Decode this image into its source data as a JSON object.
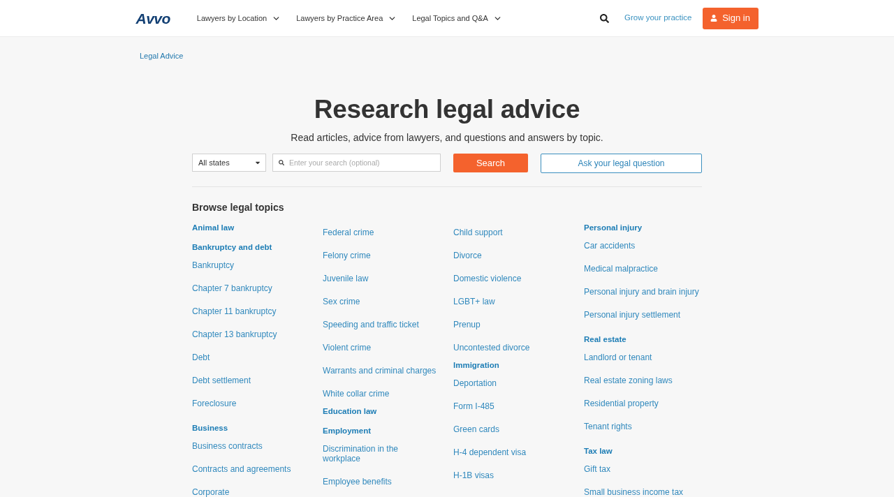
{
  "header": {
    "logo": "Avvo",
    "nav": [
      "Lawyers by Location",
      "Lawyers by Practice Area",
      "Legal Topics and Q&A"
    ],
    "grow_link": "Grow your practice",
    "sign_in": "Sign in"
  },
  "breadcrumb": "Legal Advice",
  "hero": {
    "title": "Research legal advice",
    "subtitle": "Read articles, advice from lawyers, and questions and answers by topic."
  },
  "search": {
    "state_select": {
      "value": "All states"
    },
    "query": {
      "placeholder": "Enter your search (optional)"
    },
    "search_button": "Search",
    "ask_button": "Ask your legal question"
  },
  "topics": {
    "title": "Browse legal topics",
    "columns": [
      {
        "groups": [
          {
            "heading": "Animal law"
          },
          {
            "heading": "Bankruptcy and debt",
            "links": [
              "Bankruptcy",
              "Chapter 7 bankruptcy",
              "Chapter 11 bankruptcy",
              "Chapter 13 bankruptcy",
              "Debt",
              "Debt settlement",
              "Foreclosure"
            ]
          },
          {
            "heading": "Business",
            "links": [
              "Business contracts",
              "Contracts and agreements",
              "Corporate"
            ]
          }
        ]
      },
      {
        "groups": [
          {
            "links": [
              "Federal crime",
              "Felony crime",
              "Juvenile law",
              "Sex crime",
              "Speeding and traffic ticket",
              "Violent crime",
              "Warrants and criminal charges",
              "White collar crime"
            ]
          },
          {
            "heading": "Education law"
          },
          {
            "heading": "Employment",
            "links": [
              "Discrimination in the workplace",
              "Employee benefits"
            ]
          }
        ]
      },
      {
        "groups": [
          {
            "links": [
              "Child support",
              "Divorce",
              "Domestic violence",
              "LGBT+ law",
              "Prenup",
              "Uncontested divorce"
            ]
          },
          {
            "heading": "Immigration",
            "links": [
              "Deportation",
              "Form I-485",
              "Green cards",
              "H-4 dependent visa",
              "H-1B visas"
            ]
          }
        ]
      },
      {
        "groups": [
          {
            "heading": "Personal injury",
            "links": [
              "Car accidents",
              "Medical malpractice",
              "Personal injury and brain injury",
              "Personal injury settlement"
            ]
          },
          {
            "heading": "Real estate",
            "links": [
              "Landlord or tenant",
              "Real estate zoning laws",
              "Residential property",
              "Tenant rights"
            ]
          },
          {
            "heading": "Tax law",
            "links": [
              "Gift tax",
              "Small business income tax"
            ]
          }
        ]
      }
    ]
  }
}
